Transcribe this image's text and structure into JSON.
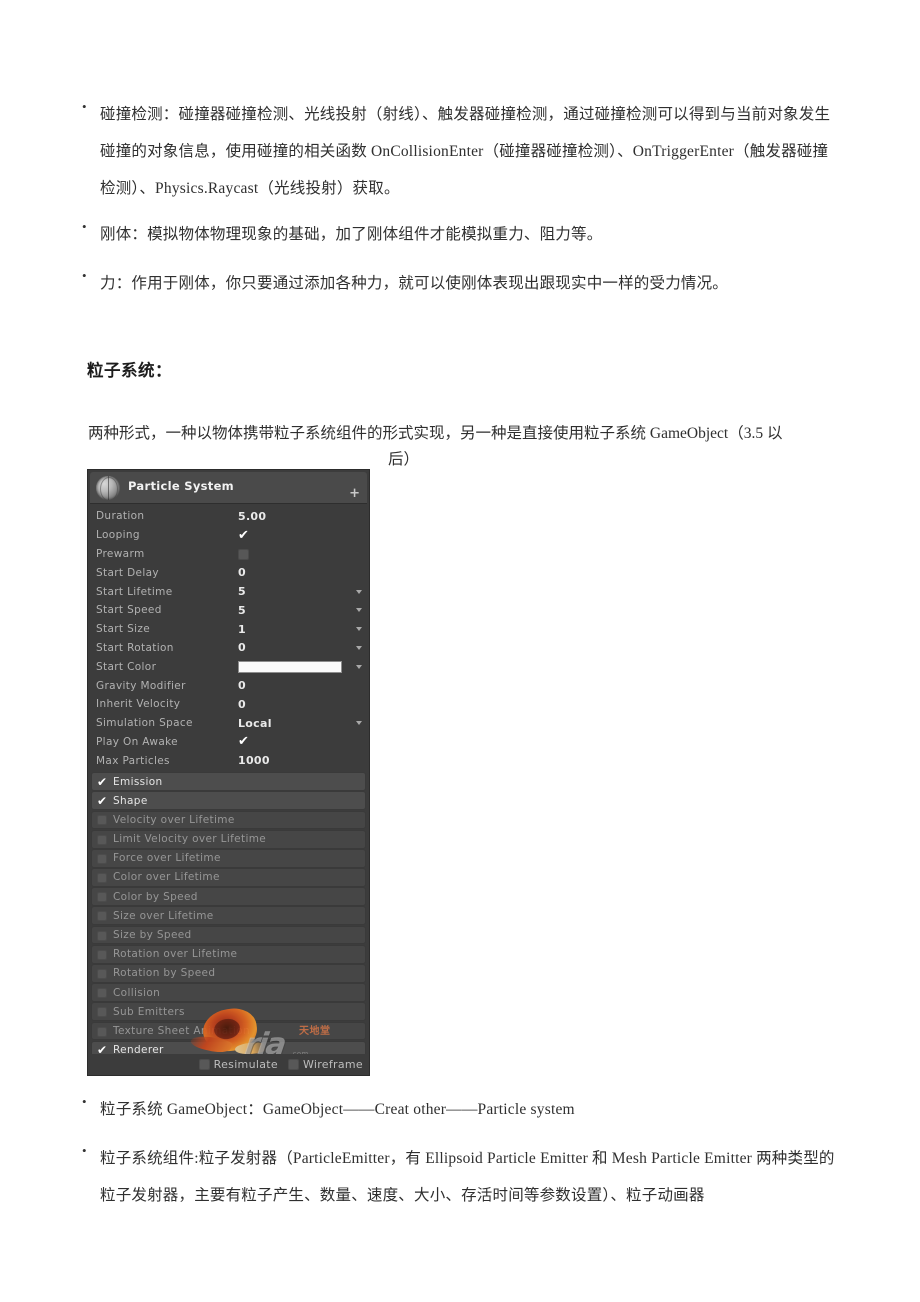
{
  "document": {
    "bullets_top": [
      {
        "dot": "•",
        "text": "碰撞检测：碰撞器碰撞检测、光线投射（射线）、触发器碰撞检测，通过碰撞检测可以得到与当前对象发生碰撞的对象信息，使用碰撞的相关函数 OnCollisionEnter（碰撞器碰撞检测）、OnTriggerEnter（触发器碰撞检测）、Physics.Raycast（光线投射）获取。"
      },
      {
        "dot": "•",
        "text": "刚体：模拟物体物理现象的基础，加了刚体组件才能模拟重力、阻力等。"
      },
      {
        "dot": "•",
        "text": "力：作用于刚体，你只要通过添加各种力，就可以使刚体表现出跟现实中一样的受力情况。"
      }
    ],
    "section_heading": "粒子系统：",
    "paragraph_line1": "两种形式，一种以物体携带粒子系统组件的形式实现，另一种是直接使用粒子系统 GameObject（3.5 以",
    "paragraph_line2": "后）",
    "bullets_bottom": [
      {
        "dot": "•",
        "text": "粒子系统 GameObject：GameObject——Creat other——Particle system"
      },
      {
        "dot": "•",
        "text": "粒子系统组件:粒子发射器（ParticleEmitter，有 Ellipsoid Particle Emitter 和 Mesh Particle Emitter 两种类型的粒子发射器，主要有粒子产生、数量、速度、大小、存活时间等参数设置）、粒子动画器"
      }
    ]
  },
  "inspector": {
    "title": "Particle System",
    "icon": "sphere-icon",
    "add_icon": "+",
    "properties": [
      {
        "label": "Duration",
        "type": "text",
        "value": "5.00",
        "dropdown": false
      },
      {
        "label": "Looping",
        "type": "check",
        "value": "✔",
        "dropdown": false
      },
      {
        "label": "Prewarm",
        "type": "checkbox",
        "value": "",
        "dropdown": false
      },
      {
        "label": "Start Delay",
        "type": "text",
        "value": "0",
        "dropdown": false
      },
      {
        "label": "Start Lifetime",
        "type": "text",
        "value": "5",
        "dropdown": true
      },
      {
        "label": "Start Speed",
        "type": "text",
        "value": "5",
        "dropdown": true
      },
      {
        "label": "Start Size",
        "type": "text",
        "value": "1",
        "dropdown": true
      },
      {
        "label": "Start Rotation",
        "type": "text",
        "value": "0",
        "dropdown": true
      },
      {
        "label": "Start Color",
        "type": "color",
        "value": "#fcfcfc",
        "dropdown": true
      },
      {
        "label": "Gravity Modifier",
        "type": "text",
        "value": "0",
        "dropdown": false
      },
      {
        "label": "Inherit Velocity",
        "type": "text",
        "value": "0",
        "dropdown": false
      },
      {
        "label": "Simulation Space",
        "type": "text",
        "value": "Local",
        "dropdown": true
      },
      {
        "label": "Play On Awake",
        "type": "check",
        "value": "✔",
        "dropdown": false
      },
      {
        "label": "Max Particles",
        "type": "text",
        "value": "1000",
        "dropdown": false
      }
    ],
    "modules": [
      {
        "label": "Emission",
        "enabled": true
      },
      {
        "label": "Shape",
        "enabled": true
      },
      {
        "label": "Velocity over Lifetime",
        "enabled": false
      },
      {
        "label": "Limit Velocity over Lifetime",
        "enabled": false
      },
      {
        "label": "Force over Lifetime",
        "enabled": false
      },
      {
        "label": "Color over Lifetime",
        "enabled": false
      },
      {
        "label": "Color by Speed",
        "enabled": false
      },
      {
        "label": "Size over Lifetime",
        "enabled": false
      },
      {
        "label": "Size by Speed",
        "enabled": false
      },
      {
        "label": "Rotation over Lifetime",
        "enabled": false
      },
      {
        "label": "Rotation by Speed",
        "enabled": false
      },
      {
        "label": "Collision",
        "enabled": false
      },
      {
        "label": "Sub Emitters",
        "enabled": false
      },
      {
        "label": "Texture Sheet Animation",
        "enabled": false
      },
      {
        "label": "Renderer",
        "enabled": true
      }
    ],
    "footer": [
      {
        "label": "Resimulate",
        "checked": false
      },
      {
        "label": "Wireframe",
        "checked": false
      }
    ],
    "check_glyph": "✔",
    "watermark": {
      "main_text": "ria",
      "sub_text": "天地堂",
      "tiny_text": ".com"
    },
    "colors": {
      "panel_bg": "#3c3c3c",
      "header_bg": "#4a4a4a",
      "module_bg": "#464646",
      "label": "#b2b2b2",
      "value": "#eaeaea"
    }
  }
}
